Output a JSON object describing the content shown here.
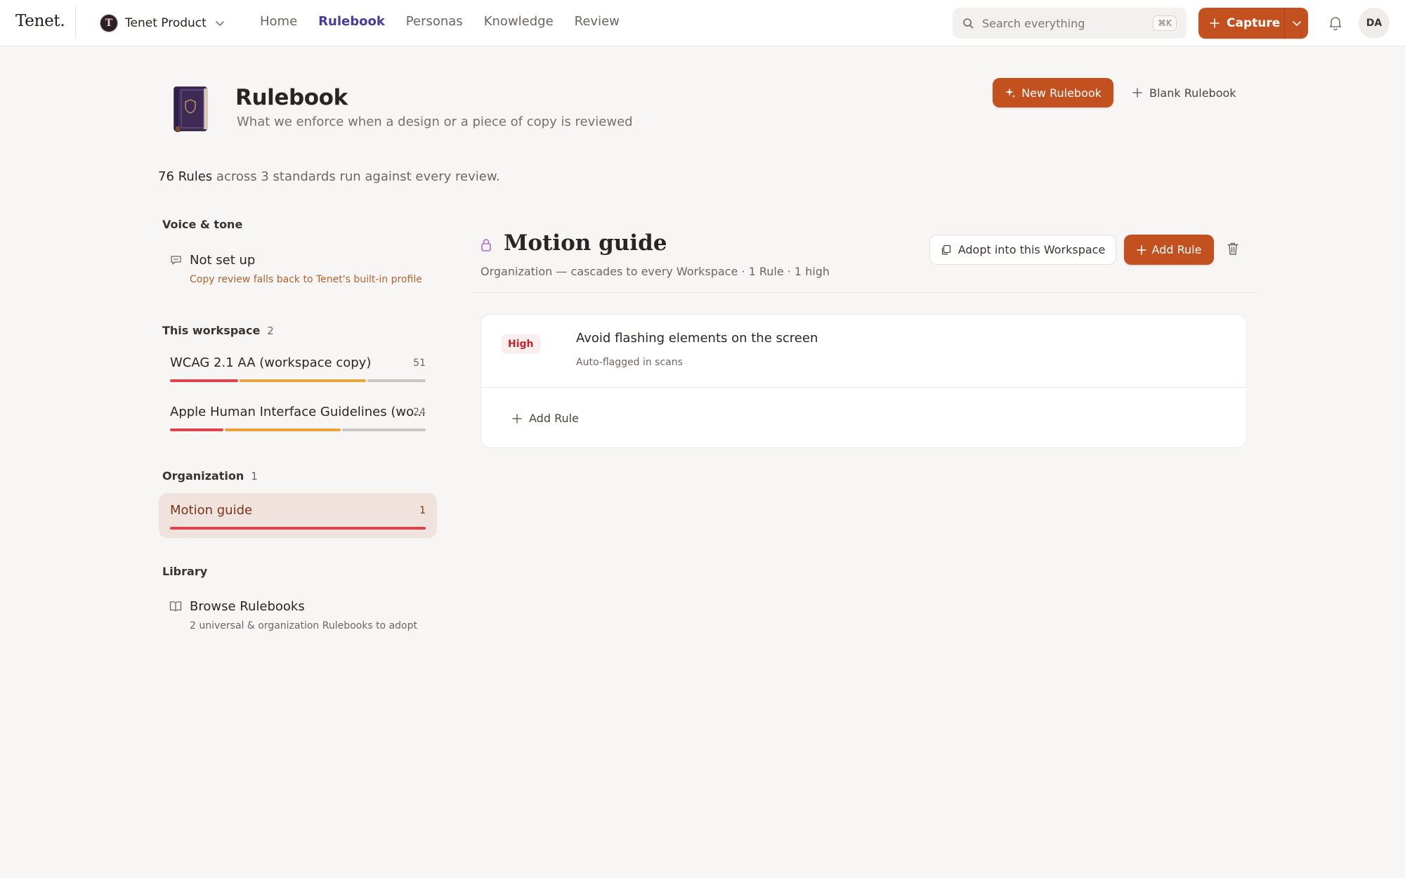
{
  "brand": "Tenet.",
  "workspace": {
    "logo_letter": "T",
    "name": "Tenet Product"
  },
  "nav": [
    "Home",
    "Rulebook",
    "Personas",
    "Knowledge",
    "Review"
  ],
  "nav_active": "Rulebook",
  "search": {
    "placeholder": "Search everything",
    "shortcut": "⌘K"
  },
  "capture_label": "Capture",
  "avatar_initials": "DA",
  "page": {
    "title": "Rulebook",
    "subtitle": "What we enforce when a design or a piece of copy is reviewed",
    "new_button": "New Rulebook",
    "blank_button": "Blank Rulebook",
    "summary_strong": "76 Rules",
    "summary_rest": " across 3 standards run against every review."
  },
  "sidebar": {
    "voice": {
      "label": "Voice & tone",
      "title": "Not set up",
      "subtitle": "Copy review falls back to Tenet's built-in profile"
    },
    "workspace": {
      "label": "This workspace",
      "count": "2",
      "items": [
        {
          "name": "WCAG 2.1 AA (workspace copy)",
          "count": "51",
          "bar": [
            27,
            50,
            23
          ]
        },
        {
          "name": "Apple Human Interface Guidelines (wo...",
          "count": "24",
          "bar": [
            21,
            46,
            33
          ]
        }
      ]
    },
    "organization": {
      "label": "Organization",
      "count": "1",
      "items": [
        {
          "name": "Motion guide",
          "count": "1",
          "bar": [
            100,
            0,
            0
          ]
        }
      ]
    },
    "library": {
      "label": "Library",
      "title": "Browse Rulebooks",
      "subtitle": "2 universal & organization Rulebooks to adopt"
    }
  },
  "detail": {
    "title": "Motion guide",
    "meta": "Organization — cascades to every Workspace · 1 Rule · 1 high",
    "adopt_button": "Adopt into this Workspace",
    "add_rule_button": "Add Rule",
    "rules": [
      {
        "severity": "High",
        "title": "Avoid flashing elements on the screen",
        "subtitle": "Auto-flagged in scans"
      }
    ],
    "add_rule_inline": "Add Rule"
  },
  "colors": {
    "accent": "#c2511f",
    "nav_active": "#4b3a9e",
    "severity_high": "#e0434b",
    "severity_medium": "#eaa23b",
    "severity_low": "#c9c5c1",
    "selected_bg": "#f0e2dc"
  }
}
